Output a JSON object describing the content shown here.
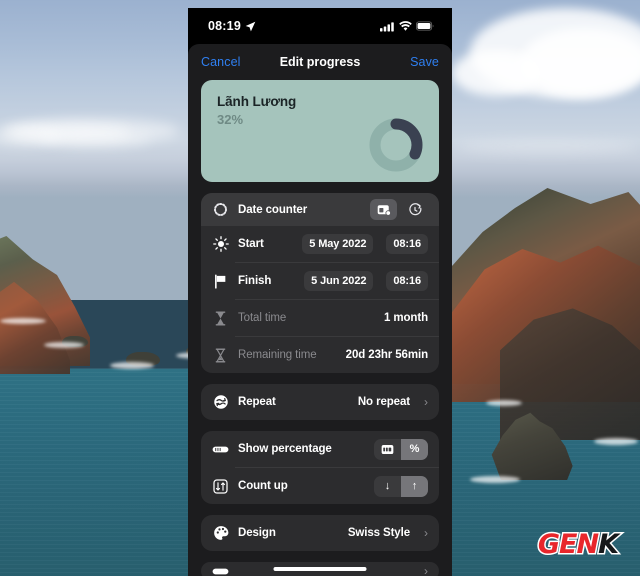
{
  "status_bar": {
    "time": "08:19",
    "location_icon": "location-arrow-icon",
    "signal_icon": "cellular-signal-icon",
    "wifi_icon": "wifi-icon",
    "battery_icon": "battery-icon"
  },
  "navbar": {
    "cancel_label": "Cancel",
    "title": "Edit progress",
    "save_label": "Save",
    "accent_color": "#2f7ff0"
  },
  "preview_card": {
    "title": "Lãnh Lương",
    "percent_label": "32%",
    "percent_value": 32,
    "background_color": "#a5c4bc",
    "ring_color": "#3a4151",
    "ring_track_color": "#8fb1aa"
  },
  "date_counter": {
    "header_label": "Date counter",
    "header_icon": "dashed-circle-icon",
    "mode_buttons": [
      {
        "icon": "widget-calendar-icon",
        "active": true
      },
      {
        "icon": "stopwatch-icon",
        "active": false
      }
    ],
    "rows": [
      {
        "icon": "sun-icon",
        "label": "Start",
        "date": "5 May 2022",
        "time": "08:16",
        "muted": false
      },
      {
        "icon": "flag-icon",
        "label": "Finish",
        "date": "5 Jun 2022",
        "time": "08:16",
        "muted": false
      },
      {
        "icon": "hourglass-icon",
        "label": "Total time",
        "value": "1 month",
        "muted": true
      },
      {
        "icon": "hourglass-icon",
        "label": "Remaining time",
        "value": "20d 23hr 56min",
        "muted": true
      }
    ]
  },
  "repeat_section": {
    "icon": "repeat-icon",
    "label": "Repeat",
    "value": "No repeat",
    "chevron": "chevron-right-icon"
  },
  "display_section": {
    "rows": [
      {
        "icon": "progress-bar-icon",
        "label": "Show percentage",
        "options": [
          {
            "icon": "counter-box-icon",
            "label": "",
            "active": false
          },
          {
            "icon": "percent-icon",
            "label": "%",
            "active": true
          }
        ]
      },
      {
        "icon": "sort-arrows-icon",
        "label": "Count up",
        "options": [
          {
            "icon": "arrow-down-icon",
            "label": "↓",
            "active": false
          },
          {
            "icon": "arrow-up-icon",
            "label": "↑",
            "active": true
          }
        ]
      }
    ]
  },
  "design_section": {
    "icon": "palette-icon",
    "label": "Design",
    "value": "Swiss Style",
    "chevron": "chevron-right-icon"
  },
  "watermark": {
    "text_primary": "GEN",
    "text_secondary": "K",
    "primary_color": "#e8262b",
    "secondary_color": "#16181a"
  }
}
